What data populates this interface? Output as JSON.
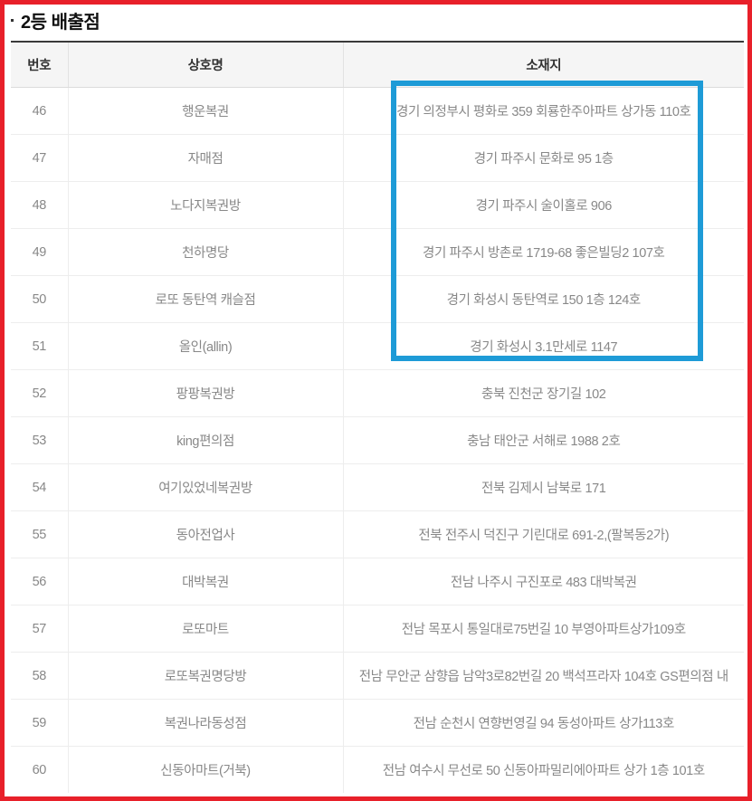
{
  "page": {
    "title": "2등 배출점",
    "border_color": "#e8202a",
    "highlight_color": "#1e9bd7"
  },
  "table": {
    "columns": [
      "번호",
      "상호명",
      "소재지"
    ],
    "rows": [
      {
        "no": "46",
        "name": "행운복권",
        "addr": "경기 의정부시 평화로 359 회룡한주아파트 상가동 110호",
        "highlighted": true
      },
      {
        "no": "47",
        "name": "자매점",
        "addr": "경기 파주시 문화로 95 1층",
        "highlighted": true
      },
      {
        "no": "48",
        "name": "노다지복권방",
        "addr": "경기 파주시 술이홀로 906",
        "highlighted": true
      },
      {
        "no": "49",
        "name": "천하명당",
        "addr": "경기 파주시 방촌로 1719-68 좋은빌딩2 107호",
        "highlighted": true
      },
      {
        "no": "50",
        "name": "로또 동탄역 캐슬점",
        "addr": "경기 화성시 동탄역로 150 1층 124호",
        "highlighted": true
      },
      {
        "no": "51",
        "name": "올인(allin)",
        "addr": "경기 화성시 3.1만세로 1147",
        "highlighted": true
      },
      {
        "no": "52",
        "name": "팡팡복권방",
        "addr": "충북 진천군 장기길 102",
        "highlighted": false
      },
      {
        "no": "53",
        "name": "king편의점",
        "addr": "충남 태안군 서해로 1988 2호",
        "highlighted": false
      },
      {
        "no": "54",
        "name": "여기있었네복권방",
        "addr": "전북 김제시 남북로 171",
        "highlighted": false
      },
      {
        "no": "55",
        "name": "동아전업사",
        "addr": "전북 전주시 덕진구 기린대로 691-2,(팔복동2가)",
        "highlighted": false
      },
      {
        "no": "56",
        "name": "대박복권",
        "addr": "전남 나주시 구진포로 483 대박복권",
        "highlighted": false
      },
      {
        "no": "57",
        "name": "로또마트",
        "addr": "전남 목포시 통일대로75번길 10 부영아파트상가109호",
        "highlighted": false
      },
      {
        "no": "58",
        "name": "로또복권명당방",
        "addr": "전남 무안군 삼향읍 남악3로82번길 20 백석프라자 104호 GS편의점 내",
        "highlighted": false
      },
      {
        "no": "59",
        "name": "복권나라동성점",
        "addr": "전남 순천시 연향번영길 94 동성아파트 상가113호",
        "highlighted": false
      },
      {
        "no": "60",
        "name": "신동아마트(거북)",
        "addr": "전남 여수시 무선로 50 신동아파밀리에아파트 상가 1층 101호",
        "highlighted": false
      }
    ]
  }
}
